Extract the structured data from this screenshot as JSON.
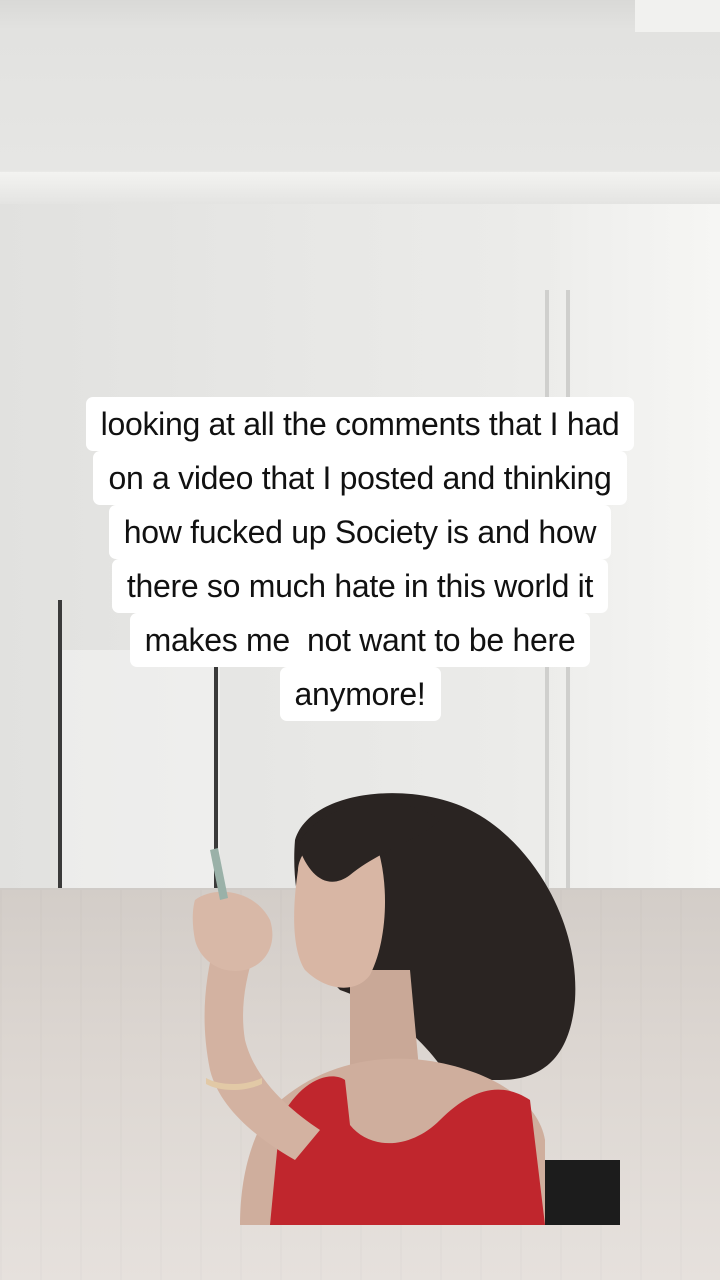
{
  "overlay_caption": {
    "lines": [
      "looking at all the comments that I had",
      "on a video that I posted and thinking",
      "how fucked up Society is and how",
      "there so much hate in this world it",
      "makes me  not want to be here",
      "anymore!"
    ]
  },
  "colors": {
    "caption_background": "#ffffff",
    "caption_text": "#111111",
    "wall": "#e7e7e5",
    "floor": "#dcd6d1",
    "top_color": "#c0262d",
    "hair": "#2a2422"
  }
}
